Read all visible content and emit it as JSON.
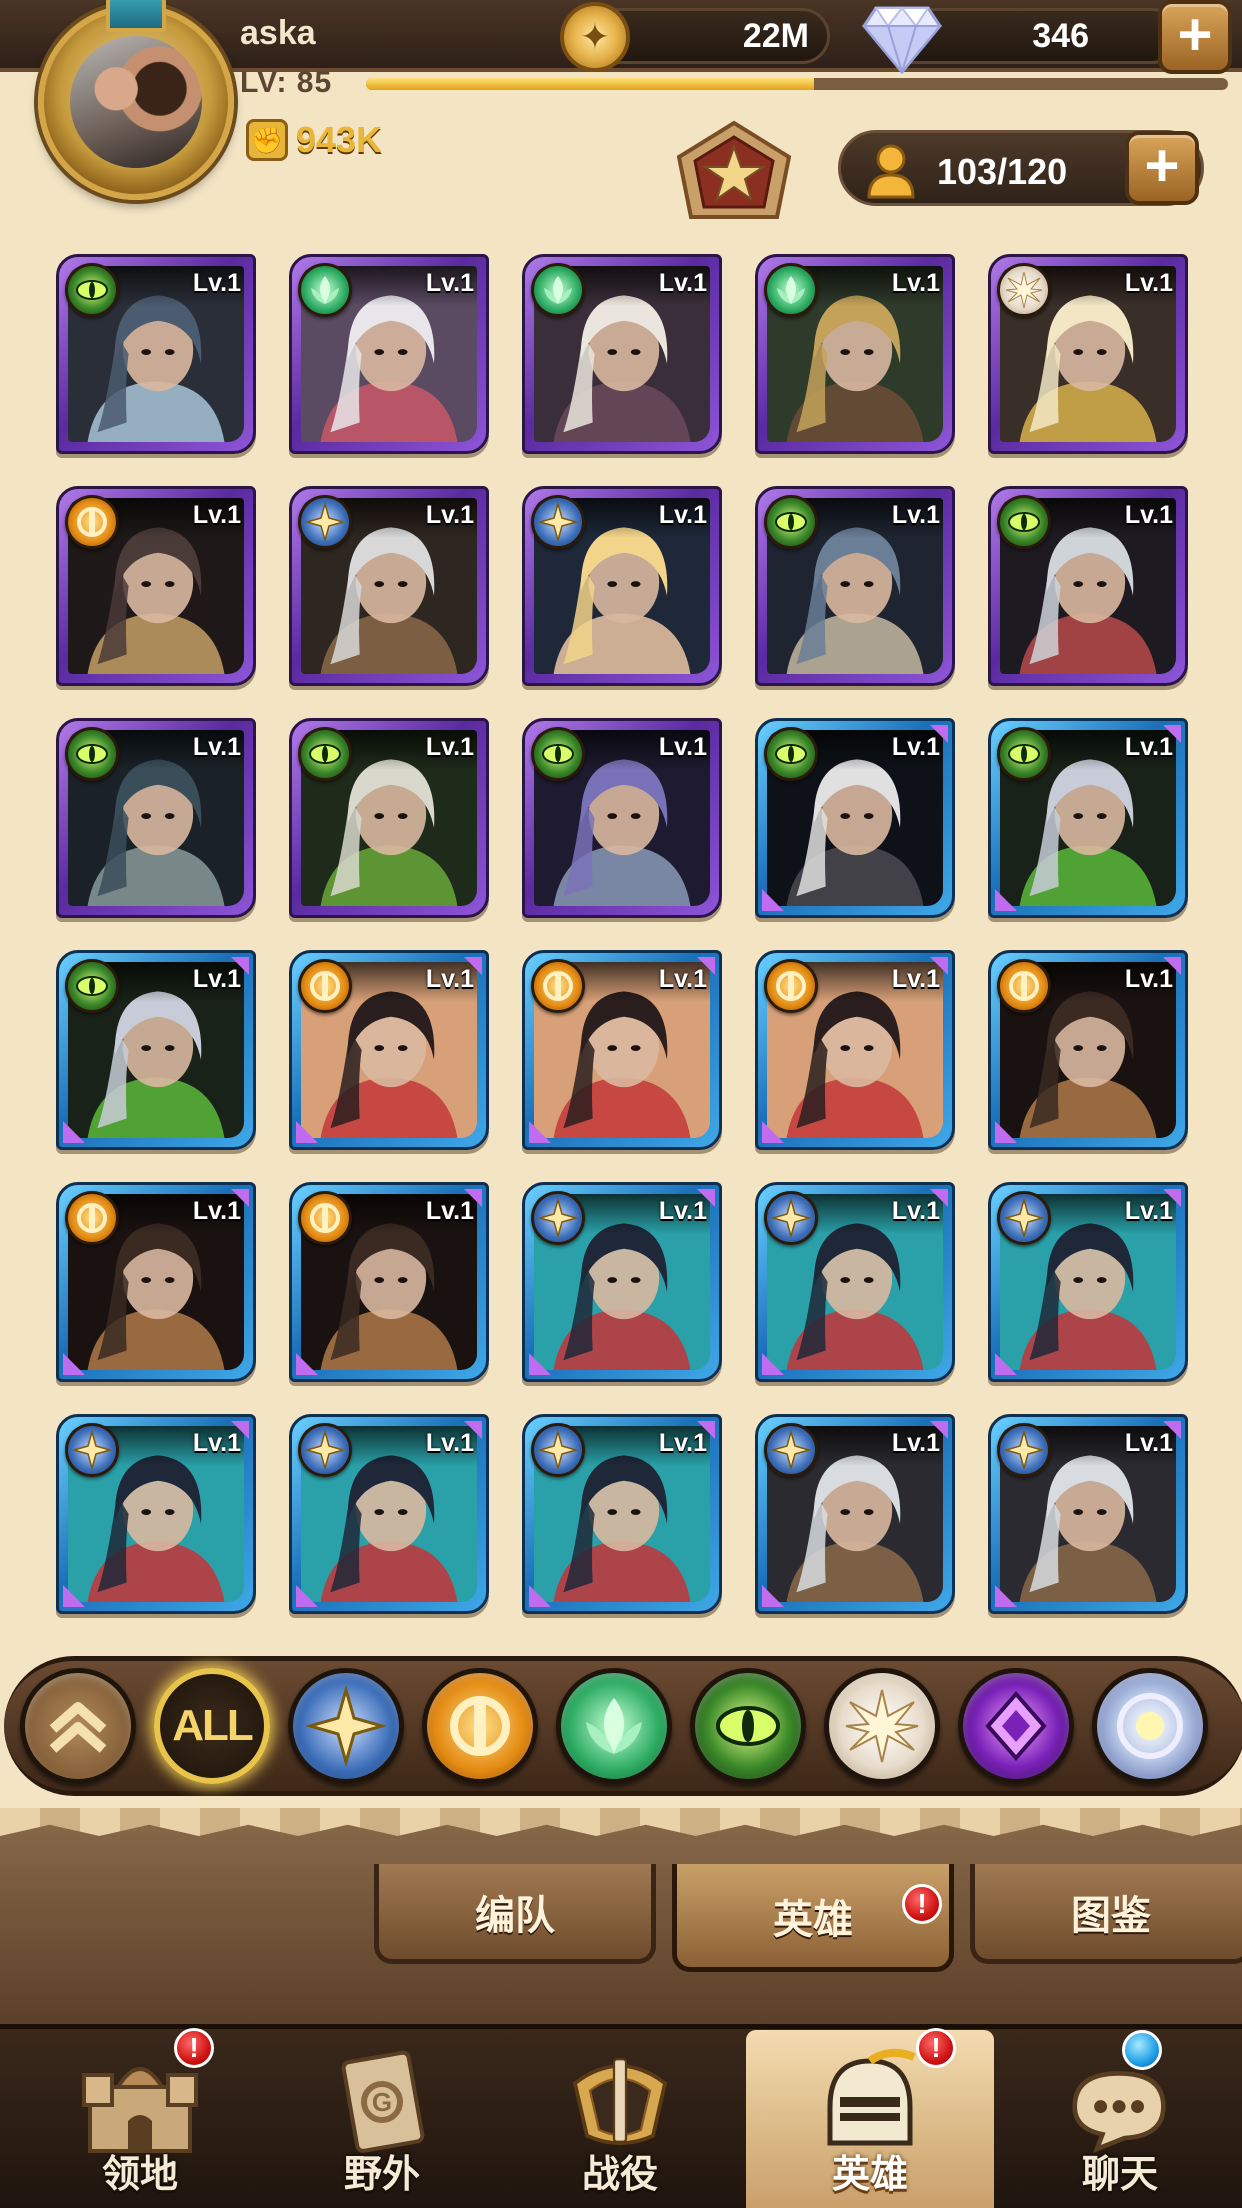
{
  "player": {
    "name": "aska",
    "level_label": "LV: 85",
    "xp_fraction": 0.52,
    "power": "943K"
  },
  "currency": {
    "gold": "22M",
    "gems": "346",
    "plus": "+"
  },
  "roster": {
    "capacity": "103/120",
    "plus": "+"
  },
  "heroes": [
    {
      "level": "Lv.1",
      "faction": "graveborn",
      "rarity": "purple",
      "palette": [
        "#4b5b70",
        "#a8c4d8",
        "#2a2e38"
      ]
    },
    {
      "level": "Lv.1",
      "faction": "wilder",
      "rarity": "purple",
      "palette": [
        "#e8e6ea",
        "#c9586a",
        "#5a4a62"
      ]
    },
    {
      "level": "Lv.1",
      "faction": "wilder",
      "rarity": "purple",
      "palette": [
        "#ebe6dd",
        "#6a4a5a",
        "#3a2e3a"
      ]
    },
    {
      "level": "Lv.1",
      "faction": "wilder",
      "rarity": "purple",
      "palette": [
        "#c4a25a",
        "#6b4d36",
        "#2e3a2a"
      ]
    },
    {
      "level": "Lv.1",
      "faction": "celestial",
      "rarity": "purple",
      "palette": [
        "#f2e6c4",
        "#d8b24a",
        "#3a2e28"
      ]
    },
    {
      "level": "Lv.1",
      "faction": "mauler",
      "rarity": "purple",
      "palette": [
        "#4a3a38",
        "#c4a066",
        "#1e1818"
      ]
    },
    {
      "level": "Lv.1",
      "faction": "lightbearer",
      "rarity": "purple",
      "palette": [
        "#d8d8d8",
        "#8a6a4a",
        "#2e2620"
      ]
    },
    {
      "level": "Lv.1",
      "faction": "lightbearer",
      "rarity": "purple",
      "palette": [
        "#f2d48a",
        "#eac6a4",
        "#1e2838"
      ]
    },
    {
      "level": "Lv.1",
      "faction": "graveborn",
      "rarity": "purple",
      "palette": [
        "#6a7e96",
        "#c4b8a0",
        "#1e2430"
      ]
    },
    {
      "level": "Lv.1",
      "faction": "graveborn",
      "rarity": "purple",
      "palette": [
        "#cfd4d8",
        "#b84a4a",
        "#1e1a22"
      ]
    },
    {
      "level": "Lv.1",
      "faction": "graveborn",
      "rarity": "purple",
      "palette": [
        "#3a4e5a",
        "#8a9a9a",
        "#1a2228"
      ]
    },
    {
      "level": "Lv.1",
      "faction": "graveborn",
      "rarity": "purple",
      "palette": [
        "#d8d8cc",
        "#6aa83a",
        "#1e2a1a"
      ]
    },
    {
      "level": "Lv.1",
      "faction": "graveborn",
      "rarity": "purple",
      "palette": [
        "#7a72b8",
        "#8a9ab8",
        "#1e1a30"
      ]
    },
    {
      "level": "Lv.1",
      "faction": "graveborn",
      "rarity": "blue",
      "palette": [
        "#e0e0e0",
        "#4a4a50",
        "#0e1218"
      ]
    },
    {
      "level": "Lv.1",
      "faction": "graveborn",
      "rarity": "blue",
      "palette": [
        "#c8ccd8",
        "#5ab83a",
        "#182218"
      ]
    },
    {
      "level": "Lv.1",
      "faction": "graveborn",
      "rarity": "blue",
      "palette": [
        "#c8ccd8",
        "#5ab83a",
        "#182218"
      ]
    },
    {
      "level": "Lv.1",
      "faction": "mauler",
      "rarity": "blue",
      "palette": [
        "#2a1e1e",
        "#c4383a",
        "#d8a078"
      ]
    },
    {
      "level": "Lv.1",
      "faction": "mauler",
      "rarity": "blue",
      "palette": [
        "#2a1e1e",
        "#c4383a",
        "#d8a078"
      ]
    },
    {
      "level": "Lv.1",
      "faction": "mauler",
      "rarity": "blue",
      "palette": [
        "#2a1e1e",
        "#c4383a",
        "#d8a078"
      ]
    },
    {
      "level": "Lv.1",
      "faction": "mauler",
      "rarity": "blue",
      "palette": [
        "#3a2a22",
        "#b07a48",
        "#1a1210"
      ]
    },
    {
      "level": "Lv.1",
      "faction": "mauler",
      "rarity": "blue",
      "palette": [
        "#3a2a22",
        "#b07a48",
        "#1a1210"
      ]
    },
    {
      "level": "Lv.1",
      "faction": "mauler",
      "rarity": "blue",
      "palette": [
        "#3a2a22",
        "#b07a48",
        "#1a1210"
      ]
    },
    {
      "level": "Lv.1",
      "faction": "lightbearer",
      "rarity": "blue",
      "palette": [
        "#1e2838",
        "#c4343a",
        "#2aa0a8"
      ]
    },
    {
      "level": "Lv.1",
      "faction": "lightbearer",
      "rarity": "blue",
      "palette": [
        "#1e2838",
        "#c4343a",
        "#2aa0a8"
      ]
    },
    {
      "level": "Lv.1",
      "faction": "lightbearer",
      "rarity": "blue",
      "palette": [
        "#1e2838",
        "#c4343a",
        "#2aa0a8"
      ]
    },
    {
      "level": "Lv.1",
      "faction": "lightbearer",
      "rarity": "blue",
      "palette": [
        "#1e2838",
        "#c4343a",
        "#2aa0a8"
      ]
    },
    {
      "level": "Lv.1",
      "faction": "lightbearer",
      "rarity": "blue",
      "palette": [
        "#1e2838",
        "#c4343a",
        "#2aa0a8"
      ]
    },
    {
      "level": "Lv.1",
      "faction": "lightbearer",
      "rarity": "blue",
      "palette": [
        "#1e2838",
        "#c4343a",
        "#2aa0a8"
      ]
    },
    {
      "level": "Lv.1",
      "faction": "lightbearer",
      "rarity": "blue",
      "palette": [
        "#d8dce0",
        "#8a6a4a",
        "#2a2a30"
      ]
    },
    {
      "level": "Lv.1",
      "faction": "lightbearer",
      "rarity": "blue",
      "palette": [
        "#d8dce0",
        "#8a6a4a",
        "#2a2a30"
      ]
    }
  ],
  "filters": {
    "all_label": "ALL",
    "factions": [
      "lightbearer",
      "mauler",
      "wilder",
      "graveborn",
      "celestial",
      "hypogean",
      "dimensional"
    ]
  },
  "subtabs": [
    {
      "label": "编队",
      "active": false,
      "badge": ""
    },
    {
      "label": "英雄",
      "active": true,
      "badge": "!"
    },
    {
      "label": "图鉴",
      "active": false,
      "badge": ""
    }
  ],
  "nav": [
    {
      "label": "领地",
      "icon": "castle-icon",
      "badge": "!",
      "active": false
    },
    {
      "label": "野外",
      "icon": "scroll-map-icon",
      "badge": "",
      "active": false
    },
    {
      "label": "战役",
      "icon": "sword-shield-icon",
      "badge": "",
      "active": false
    },
    {
      "label": "英雄",
      "icon": "helmet-icon",
      "badge": "!",
      "active": true
    },
    {
      "label": "聊天",
      "icon": "chat-bubble-icon",
      "badge": "",
      "active": false
    }
  ]
}
